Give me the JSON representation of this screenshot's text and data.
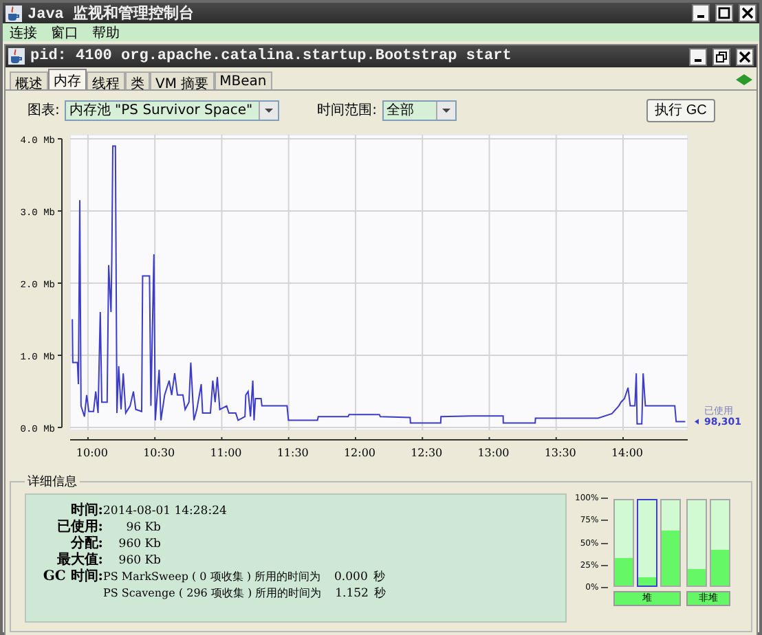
{
  "window": {
    "title": "Java 监视和管理控制台"
  },
  "menu": [
    "连接",
    "窗口",
    "帮助"
  ],
  "internal_frame": {
    "title": "pid: 4100 org.apache.catalina.startup.Bootstrap start"
  },
  "tabs": [
    {
      "label": "概述",
      "selected": false
    },
    {
      "label": "内存",
      "selected": true
    },
    {
      "label": "线程",
      "selected": false
    },
    {
      "label": "类",
      "selected": false
    },
    {
      "label": "VM 摘要",
      "selected": false
    },
    {
      "label": "MBean",
      "selected": false
    }
  ],
  "toolbar": {
    "chart_label": "图表:",
    "chart_select": "内存池 \"PS Survivor Space\"",
    "range_label": "时间范围:",
    "range_select": "全部",
    "gc_button": "执行 GC"
  },
  "chart": {
    "legend": {
      "value": "98,301"
    },
    "chart_data": {
      "type": "line",
      "grid": true,
      "xlim": [
        592,
        869
      ],
      "ylim": [
        0,
        4
      ],
      "xticks": [
        {
          "value": 600,
          "label": "10:00"
        },
        {
          "value": 630,
          "label": "10:30"
        },
        {
          "value": 660,
          "label": "11:00"
        },
        {
          "value": 690,
          "label": "11:30"
        },
        {
          "value": 720,
          "label": "12:00"
        },
        {
          "value": 750,
          "label": "12:30"
        },
        {
          "value": 780,
          "label": "13:00"
        },
        {
          "value": 810,
          "label": "13:30"
        },
        {
          "value": 840,
          "label": "14:00"
        }
      ],
      "yticks": [
        {
          "value": 0,
          "label": "0.0 Mb"
        },
        {
          "value": 1,
          "label": "1.0 Mb"
        },
        {
          "value": 2,
          "label": "2.0 Mb"
        },
        {
          "value": 3,
          "label": "3.0 Mb"
        },
        {
          "value": 4,
          "label": "4.0 Mb"
        }
      ],
      "x": [
        593,
        593.2,
        595.3,
        595.7,
        596.3,
        596.9,
        598.4,
        599.4,
        600.4,
        602.5,
        603.5,
        604.5,
        605.5,
        606.2,
        608.6,
        609.3,
        610.3,
        610.7,
        611.1,
        612.3,
        613,
        613.8,
        614.8,
        615.8,
        616.9,
        618.9,
        620.4,
        621.4,
        624.1,
        624.5,
        627.6,
        628.2,
        629.6,
        630.2,
        631.9,
        632.7,
        634.4,
        636.4,
        637.5,
        638.9,
        640.1,
        642.6,
        643.6,
        645.3,
        646.1,
        647.5,
        648.8,
        650.8,
        651.4,
        654.9,
        656,
        657,
        658,
        659.1,
        662.2,
        663.2,
        666.3,
        667.3,
        670.4,
        670.8,
        671.8,
        672.9,
        673.9,
        674.5,
        675.1,
        677.6,
        678,
        689.3,
        689.9,
        702.9,
        703.3,
        716.7,
        717.1,
        730.7,
        731.1,
        744.5,
        744.6,
        758.2,
        758.3,
        772.2,
        786.2,
        786.3,
        800.6,
        800.7,
        828.8,
        835,
        838.1,
        839.1,
        840.6,
        842.2,
        843.2,
        845.3,
        845.9,
        846.3,
        848.4,
        849,
        850,
        863.2,
        863.8,
        867.9
      ],
      "series": [
        {
          "name": "已使用",
          "color": "#3c3cc8",
          "values": [
            1.5,
            0.9,
            0.9,
            0.6,
            3.15,
            0.3,
            0.15,
            0.45,
            0.22,
            0.22,
            0.5,
            0.2,
            1.6,
            0.35,
            0.35,
            2.25,
            1.6,
            2.35,
            3.9,
            3.9,
            0.2,
            0.85,
            0.25,
            0.75,
            0.2,
            0.3,
            0.5,
            0.25,
            0.22,
            2.1,
            2.1,
            0.3,
            2.4,
            0.1,
            0.8,
            0.1,
            0.45,
            0.65,
            0.45,
            0.75,
            0.45,
            0.45,
            0.25,
            0.35,
            0.9,
            0.1,
            0.25,
            0.6,
            0.2,
            0.2,
            0.65,
            0.35,
            0.7,
            0.25,
            0.3,
            0.2,
            0.2,
            0.1,
            0.15,
            0.45,
            0.5,
            0.15,
            0.65,
            0.1,
            0.4,
            0.4,
            0.3,
            0.3,
            0.1,
            0.1,
            0.15,
            0.15,
            0.18,
            0.18,
            0.15,
            0.14,
            0.06,
            0.06,
            0.15,
            0.16,
            0.16,
            0.06,
            0.06,
            0.13,
            0.13,
            0.19,
            0.3,
            0.35,
            0.4,
            0.55,
            0.3,
            0.3,
            0.75,
            0.05,
            0.05,
            0.75,
            0.3,
            0.3,
            0.08,
            0.08
          ]
        }
      ]
    }
  },
  "details": {
    "title": "详细信息",
    "rows": [
      {
        "kind": "time",
        "label": "时间:",
        "value": "2014-08-01 14:28:24"
      },
      {
        "kind": "size",
        "label": "已使用:",
        "value": "96 Kb"
      },
      {
        "kind": "size",
        "label": "分配:",
        "value": "960 Kb"
      },
      {
        "kind": "size",
        "label": "最大值:",
        "value": "960 Kb"
      }
    ],
    "gc": {
      "label": "GC 时间:",
      "collectors": [
        {
          "text": "PS MarkSweep ( 0 项收集 ) 所用的时间为",
          "value": "0.000",
          "unit": "秒"
        },
        {
          "text": "PS Scavenge ( 296 项收集 ) 所用的时间为",
          "value": "1.152",
          "unit": "秒"
        }
      ]
    }
  },
  "memory_bars": {
    "axis": [
      "100%",
      "75%",
      "50%",
      "25%",
      "0%"
    ],
    "groups": [
      {
        "label": "堆",
        "bars": [
          {
            "level": 0.33,
            "selected": false
          },
          {
            "level": 0.1,
            "selected": true
          },
          {
            "level": 0.65,
            "selected": false
          }
        ]
      },
      {
        "label": "非堆",
        "bars": [
          {
            "level": 0.19,
            "selected": false
          },
          {
            "level": 0.42,
            "selected": false
          }
        ]
      }
    ]
  }
}
